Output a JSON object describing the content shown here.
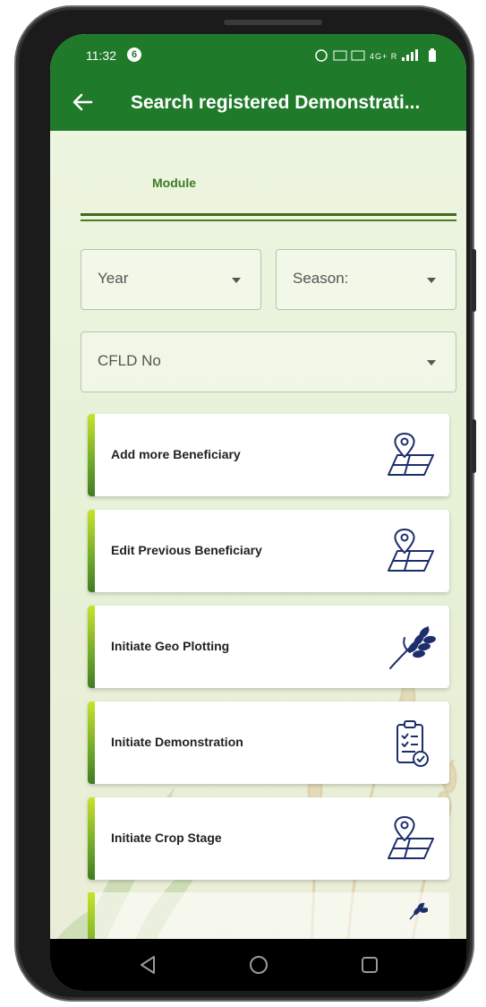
{
  "status_bar": {
    "time": "11:32",
    "notification_badge": "6",
    "indicators": "4G+ R"
  },
  "app_bar": {
    "title": "Search registered Demonstrati..."
  },
  "tabs": {
    "module_label": "Module"
  },
  "filters": {
    "year": {
      "label": "Year"
    },
    "season": {
      "label": "Season:"
    },
    "cfld": {
      "label": "CFLD No"
    }
  },
  "actions": [
    {
      "label": "Add more Beneficiary",
      "icon": "map-pin-plot-icon"
    },
    {
      "label": "Edit Previous Beneficiary",
      "icon": "map-pin-plot-icon"
    },
    {
      "label": "Initiate Geo Plotting",
      "icon": "wheat-icon"
    },
    {
      "label": "Initiate Demonstration",
      "icon": "clipboard-check-icon"
    },
    {
      "label": "Initiate Crop Stage",
      "icon": "map-pin-plot-icon"
    }
  ],
  "colors": {
    "app_bar": "#1f7a2a",
    "accent_tab": "#3d7a22",
    "icon_stroke": "#1d2f6b"
  },
  "nav": {
    "back": "back-triangle-icon",
    "home": "home-circle-icon",
    "recents": "recents-square-icon"
  }
}
